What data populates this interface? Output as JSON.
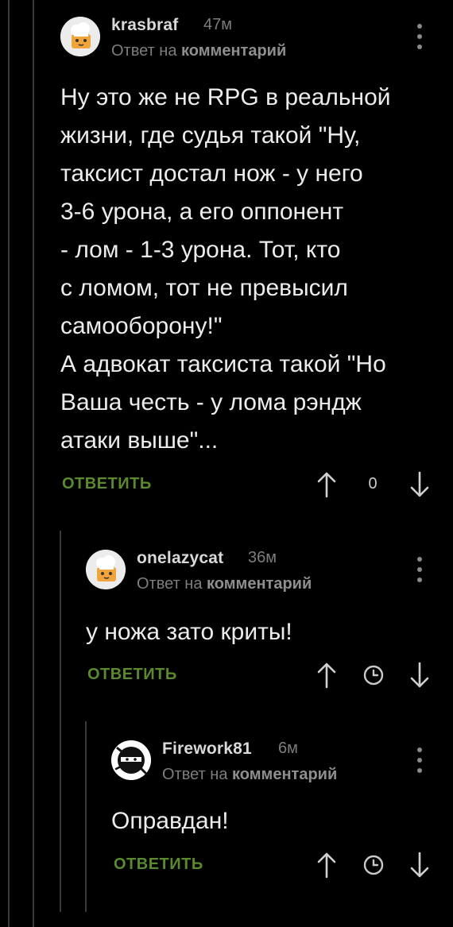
{
  "comments": [
    {
      "username": "krasbraf",
      "time": "47м",
      "reply_prefix": "Ответ на",
      "reply_target": "комментарий",
      "text": "Ну это же не RPG в реальной\nжизни, где судья такой \"Ну,\nтаксист достал нож - у него\n3-6 урона, а его оппонент\n- лом - 1-3 урона. Тот, кто\nс ломом, тот не превысил\nсамооборону!\"\nА адвокат таксиста такой \"Но\nВаша честь - у лома рэндж\nатаки выше\"...",
      "reply_label": "ОТВЕТИТЬ",
      "rating": "0"
    },
    {
      "username": "onelazycat",
      "time": "36м",
      "reply_prefix": "Ответ на",
      "reply_target": "комментарий",
      "text": "у ножа зато криты!",
      "reply_label": "ОТВЕТИТЬ"
    },
    {
      "username": "Firework81",
      "time": "6м",
      "reply_prefix": "Ответ на",
      "reply_target": "комментарий",
      "text": "Оправдан!",
      "reply_label": "ОТВЕТИТЬ"
    }
  ],
  "icons": {
    "upvote": "arrow-up-icon",
    "downvote": "arrow-down-icon",
    "clock": "clock-icon",
    "more": "more-vertical-icon"
  },
  "colors": {
    "background": "#000000",
    "accent_green": "#5b8a2e",
    "muted_text": "#7d7d7d",
    "thread_line": "#3a3a3a"
  }
}
